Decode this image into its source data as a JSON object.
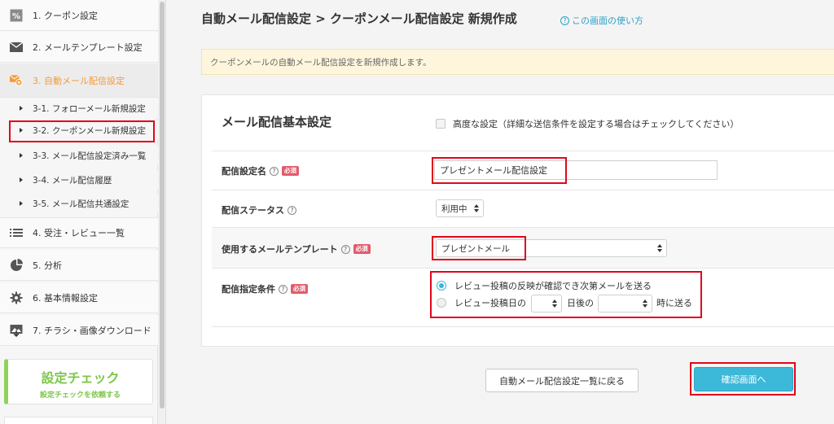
{
  "sidebar": {
    "items": [
      {
        "label": "1. クーポン設定",
        "icon": "coupon-percent-icon"
      },
      {
        "label": "2. メールテンプレート設定",
        "icon": "envelope-icon"
      },
      {
        "label": "3. 自動メール配信設定",
        "icon": "auto-mail-gear-icon"
      },
      {
        "label": "4. 受注・レビュー一覧",
        "icon": "list-icon"
      },
      {
        "label": "5. 分析",
        "icon": "pie-chart-icon"
      },
      {
        "label": "6. 基本情報設定",
        "icon": "gear-icon"
      },
      {
        "label": "7. チラシ・画像ダウンロード",
        "icon": "image-download-icon"
      }
    ],
    "subitems": [
      {
        "label": "3-1. フォローメール新規設定"
      },
      {
        "label": "3-2. クーポンメール新規設定"
      },
      {
        "label": "3-3. メール配信設定済み一覧"
      },
      {
        "label": "3-4. メール配信履歴"
      },
      {
        "label": "3-5. メール配信共通設定"
      }
    ],
    "check": {
      "title": "設定チェック",
      "subtitle": "設定チェックを依頼する"
    }
  },
  "header": {
    "title": "自動メール配信設定 > クーポンメール配信設定 新規作成",
    "help_link": "この画面の使い方"
  },
  "notice": "クーポンメールの自動メール配信設定を新規作成します。",
  "form": {
    "section_title": "メール配信基本設定",
    "advanced_label": "高度な設定（詳細な送信条件を設定する場合はチェックしてください）",
    "required_badge": "必須",
    "name_label": "配信設定名",
    "name_value": "プレゼントメール配信設定",
    "status_label": "配信ステータス",
    "status_value": "利用中",
    "template_label": "使用するメールテンプレート",
    "template_value": "プレゼントメール",
    "condition_label": "配信指定条件",
    "condition_option1": "レビュー投稿の反映が確認でき次第メールを送る",
    "condition_option2_prefix": "レビュー投稿日の",
    "condition_option2_middle": "日後の",
    "condition_option2_suffix": "時に送る"
  },
  "buttons": {
    "back": "自動メール配信設定一覧に戻る",
    "confirm": "確認画面へ"
  },
  "colors": {
    "accent": "#f39a3b",
    "link": "#2aa3c7",
    "confirm": "#3cb8d9",
    "check_green": "#7ec64a",
    "required": "#e35b6c",
    "highlight": "#e0061b"
  }
}
